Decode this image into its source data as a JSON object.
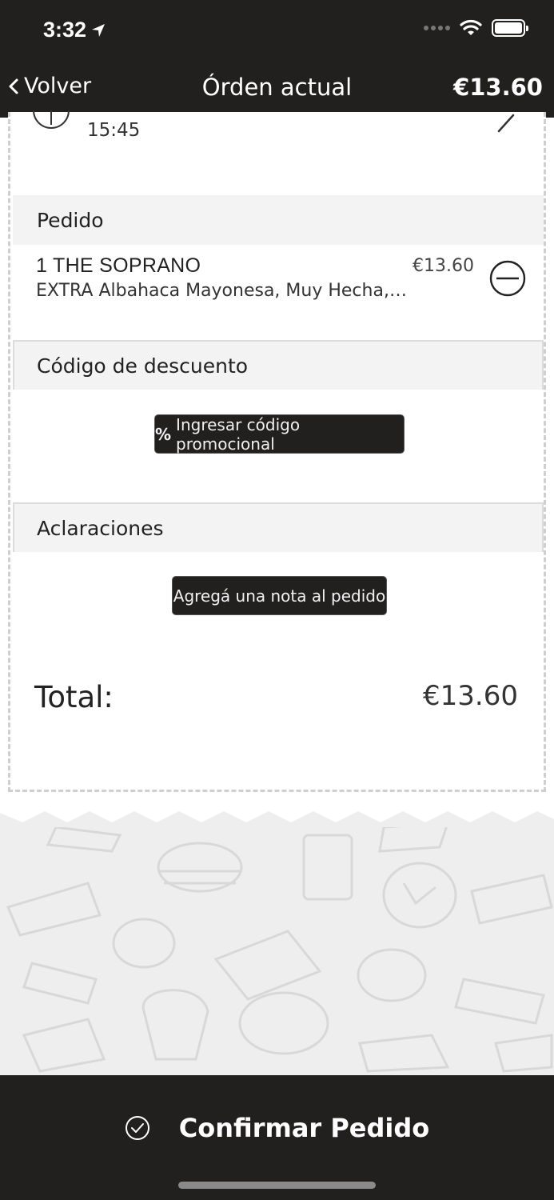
{
  "status_bar": {
    "time": "3:32"
  },
  "nav": {
    "back_label": "Volver",
    "title": "Órden actual",
    "total": "€13.60"
  },
  "pickup": {
    "time": "15:45"
  },
  "order": {
    "header": "Pedido",
    "items": [
      {
        "name": "1 THE SOPRANO",
        "description": "EXTRA Albahaca Mayonesa, Muy Hecha, S...",
        "price": "€13.60"
      }
    ]
  },
  "discount": {
    "header": "Código de descuento",
    "button_icon": "%",
    "button_label": "Ingresar código promocional"
  },
  "notes": {
    "header": "Aclaraciones",
    "button_label": "Agregá una nota al pedido"
  },
  "summary": {
    "total_label": "Total:",
    "total_value": "€13.60"
  },
  "footer": {
    "confirm_label": "Confirmar Pedido"
  },
  "colors": {
    "bar_background": "#221f1f",
    "section_background": "#f3f3f3",
    "pattern_background": "#eeeeee"
  }
}
